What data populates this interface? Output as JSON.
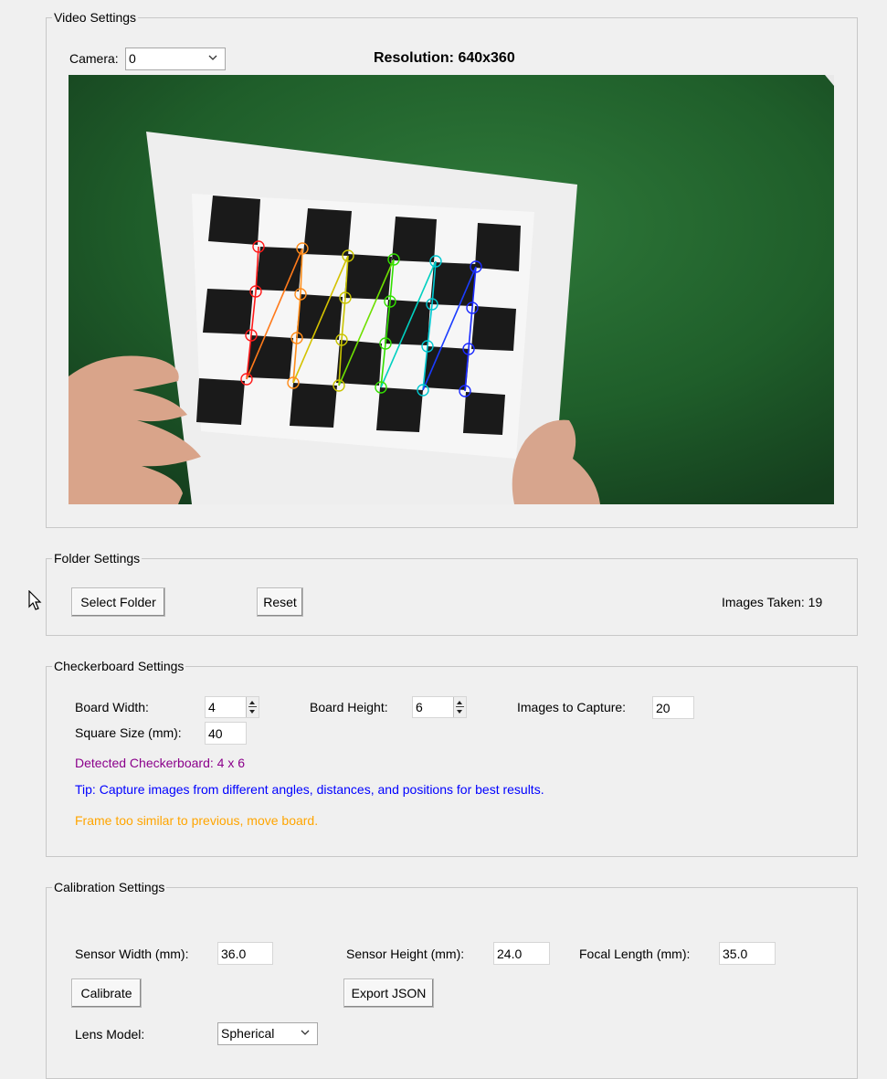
{
  "video": {
    "legend": "Video Settings",
    "camera_label": "Camera:",
    "camera_value": "0",
    "resolution": "Resolution: 640x360"
  },
  "folder": {
    "legend": "Folder Settings",
    "select_button": "Select Folder",
    "reset_button": "Reset",
    "images_taken": "Images Taken: 19"
  },
  "checkerboard": {
    "legend": "Checkerboard Settings",
    "board_width_label": "Board Width:",
    "board_width_value": "4",
    "board_height_label": "Board Height:",
    "board_height_value": "6",
    "images_to_capture_label": "Images to Capture:",
    "images_to_capture_value": "20",
    "square_size_label": "Square Size (mm):",
    "square_size_value": "40",
    "detected": "Detected Checkerboard: 4 x 6",
    "tip": "Tip: Capture images from different angles, distances, and positions for best results.",
    "warning": "Frame too similar to previous, move board.",
    "colors": {
      "detected": "#8b008b",
      "tip": "#0000ff",
      "warning": "#ffa500"
    }
  },
  "calibration": {
    "legend": "Calibration Settings",
    "sensor_width_label": "Sensor Width (mm):",
    "sensor_width_value": "36.0",
    "sensor_height_label": "Sensor Height (mm):",
    "sensor_height_value": "24.0",
    "focal_length_label": "Focal Length (mm):",
    "focal_length_value": "35.0",
    "calibrate_button": "Calibrate",
    "export_button": "Export JSON",
    "lens_model_label": "Lens Model:",
    "lens_model_value": "Spherical"
  },
  "icons": {
    "cursor": "mouse-pointer-icon",
    "dropdown": "chevron-down-icon"
  }
}
